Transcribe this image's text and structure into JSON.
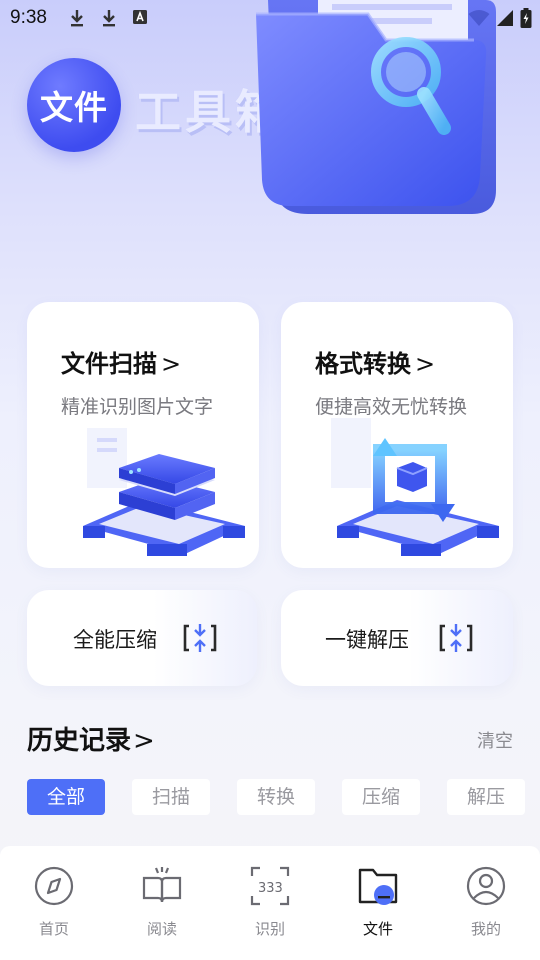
{
  "status_bar": {
    "time": "9:38",
    "left_icons": [
      "download-icon",
      "download-icon",
      "keyboard-a-icon"
    ],
    "right_icons": [
      "wifi-icon",
      "signal-icon",
      "battery-charging-icon"
    ]
  },
  "brand": {
    "badge_text": "文件",
    "title": "工具箱"
  },
  "cards": {
    "scan": {
      "title": "文件扫描",
      "chevron": ">",
      "subtitle": "精准识别图片文字"
    },
    "convert": {
      "title": "格式转换",
      "chevron": ">",
      "subtitle": "便捷高效无忧转换"
    },
    "compress": {
      "label": "全能压缩"
    },
    "decompress": {
      "label": "一键解压"
    }
  },
  "history": {
    "title": "历史记录",
    "chevron": ">",
    "clear": "清空",
    "filters": [
      "全部",
      "扫描",
      "转换",
      "压缩",
      "解压"
    ],
    "active_filter": "全部"
  },
  "nav": {
    "items": [
      {
        "label": "首页",
        "icon": "compass-icon"
      },
      {
        "label": "阅读",
        "icon": "open-book-icon"
      },
      {
        "label": "识别",
        "icon": "scan-recognize-icon"
      },
      {
        "label": "文件",
        "icon": "folder-icon"
      },
      {
        "label": "我的",
        "icon": "user-icon"
      }
    ],
    "active": "文件"
  },
  "colors": {
    "accent": "#4e6ff7",
    "brand_circle": "#4a57f2",
    "background_top": "#c9cdfb"
  }
}
